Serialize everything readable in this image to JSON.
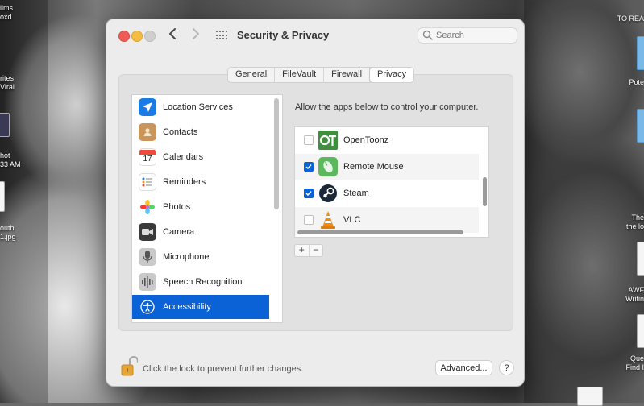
{
  "desktop": {
    "left_labels": [
      "ilms",
      "oxd",
      "rites",
      "Viral",
      "hot",
      "33 AM",
      "outh",
      "1.jpg"
    ],
    "right_labels": [
      "TO REA",
      "Pote",
      "The",
      "the lo",
      "AWF",
      "Writin",
      "Que",
      "Find I"
    ]
  },
  "window": {
    "title": "Security & Privacy",
    "search_placeholder": "Search"
  },
  "tabs": [
    {
      "label": "General",
      "active": false
    },
    {
      "label": "FileVault",
      "active": false
    },
    {
      "label": "Firewall",
      "active": false
    },
    {
      "label": "Privacy",
      "active": true
    }
  ],
  "sidebar": {
    "items": [
      {
        "label": "Location Services",
        "icon": "location-arrow-icon"
      },
      {
        "label": "Contacts",
        "icon": "contacts-book-icon"
      },
      {
        "label": "Calendars",
        "icon": "calendar-icon",
        "icon_text": "17"
      },
      {
        "label": "Reminders",
        "icon": "reminders-list-icon"
      },
      {
        "label": "Photos",
        "icon": "photos-flower-icon"
      },
      {
        "label": "Camera",
        "icon": "camera-icon"
      },
      {
        "label": "Microphone",
        "icon": "microphone-icon"
      },
      {
        "label": "Speech Recognition",
        "icon": "waveform-icon"
      },
      {
        "label": "Accessibility",
        "icon": "accessibility-person-icon",
        "selected": true
      }
    ]
  },
  "privacy": {
    "description": "Allow the apps below to control your computer.",
    "apps": [
      {
        "name": "OpenToonz",
        "checked": false,
        "icon": "opentoonz-icon"
      },
      {
        "name": "Remote Mouse",
        "checked": true,
        "icon": "remote-mouse-icon"
      },
      {
        "name": "Steam",
        "checked": true,
        "icon": "steam-icon"
      },
      {
        "name": "VLC",
        "checked": false,
        "icon": "vlc-cone-icon"
      }
    ],
    "add_label": "+",
    "remove_label": "−"
  },
  "footer": {
    "lock_text": "Click the lock to prevent further changes.",
    "advanced_label": "Advanced...",
    "help_label": "?"
  },
  "colors": {
    "selection_blue": "#0a62d6",
    "close_red": "#ee5d55",
    "minimize_yellow": "#f4bd3f"
  }
}
